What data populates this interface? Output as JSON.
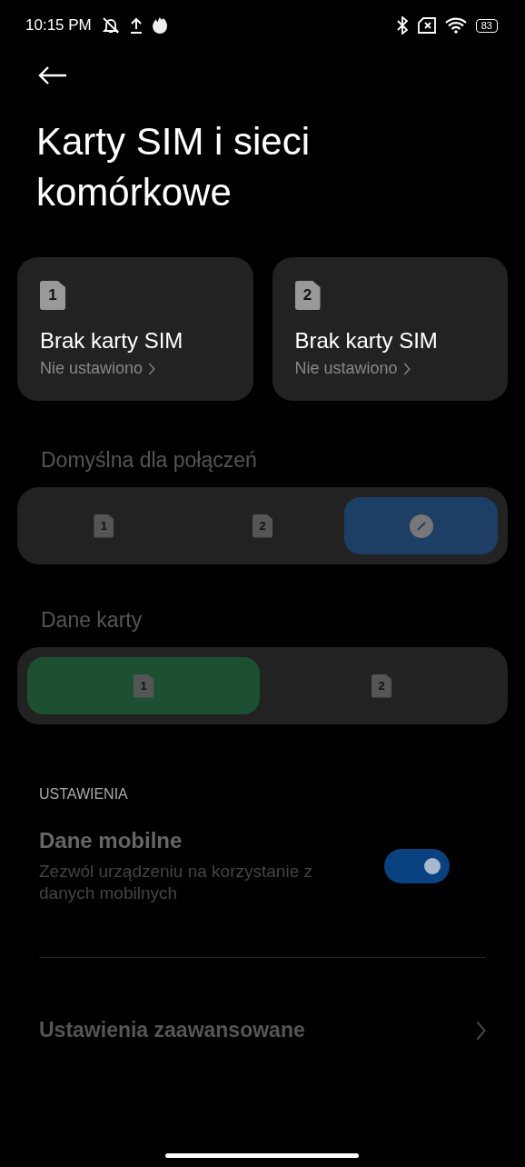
{
  "status_bar": {
    "time": "10:15 PM",
    "battery": "83"
  },
  "title": "Karty SIM i sieci komórkowe",
  "sim_cards": [
    {
      "number": "1",
      "name": "Brak karty SIM",
      "status": "Nie ustawiono"
    },
    {
      "number": "2",
      "name": "Brak karty SIM",
      "status": "Nie ustawiono"
    }
  ],
  "default_groups": [
    {
      "kind": "calls",
      "label": "Domyślna dla połączeń",
      "options": [
        {
          "kind": "sim",
          "number": "1",
          "selected": false
        },
        {
          "kind": "sim",
          "number": "2",
          "selected": false
        },
        {
          "kind": "ask",
          "selected": true
        }
      ]
    },
    {
      "kind": "data",
      "label": "Dane karty",
      "options": [
        {
          "kind": "sim",
          "number": "1",
          "selected": true
        },
        {
          "kind": "sim",
          "number": "2",
          "selected": false
        }
      ]
    }
  ],
  "settings": {
    "header": "USTAWIENIA",
    "mobile_data": {
      "title": "Dane mobilne",
      "subtitle": "Zezwól urządzeniu na korzystanie z danych mobilnych",
      "on": true
    },
    "advanced": {
      "title": "Ustawienia zaawansowane"
    }
  }
}
